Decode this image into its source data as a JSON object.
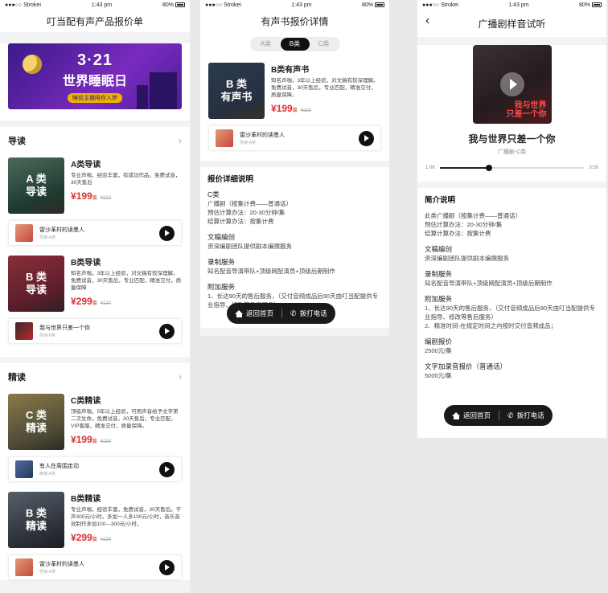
{
  "status": {
    "carrier": "●●●○○ Strokei",
    "time": "1:43 pm",
    "battery": "80%"
  },
  "p1": {
    "title": "叮当配有声产品报价单",
    "banner": {
      "line1": "3·21",
      "line2": "世界睡眠日",
      "line3": "睡前主播陪你入梦"
    },
    "sections": [
      {
        "title": "导读",
        "items": [
          {
            "cover": "A 类\n导读",
            "cover_l1": "A 类",
            "cover_l2": "导读",
            "name": "A类导读",
            "desc": "专业声咖，经验丰富，有成功作品。免费试音，30天售后",
            "price": "199",
            "unit": "篇",
            "old": "¥220",
            "sample": {
              "title": "雷沙革村的读墨人",
              "sub": "导读-A类"
            }
          },
          {
            "cover_l1": "B 类",
            "cover_l2": "导读",
            "name": "B类导读",
            "desc": "知名声咖，3年以上经验，对文稿有较深理解。免费试音，30天售后，专业匹配，精准交付，质量保障",
            "price": "299",
            "unit": "篇",
            "old": "¥220",
            "sample": {
              "title": "我与世界只差一个你",
              "sub": "导读-B类"
            }
          }
        ]
      },
      {
        "title": "精读",
        "items": [
          {
            "cover_l1": "C 类",
            "cover_l2": "精读",
            "name": "C类精读",
            "desc": "顶级声咖，5年以上经验，可用声音给予文字第二次生命。免费试音，30天售后，专业匹配，VIP客服，精准交付，质量保障。",
            "price": "199",
            "unit": "篇",
            "old": "¥220",
            "sample": {
              "title": "有人在周围走动",
              "sub": "精读-A类"
            }
          },
          {
            "cover_l1": "B 类",
            "cover_l2": "精读",
            "name": "B类精读",
            "desc": "专业声咖，经验丰富，免费试音，30天售后。干声300元/小时，多加一人多100元/小时，音乐音效制作多加100—300元/小时。",
            "price": "299",
            "unit": "篇",
            "old": "¥220",
            "sample": {
              "title": "雷沙革村的读墨人",
              "sub": "导读-A类"
            }
          }
        ]
      }
    ]
  },
  "p2": {
    "title": "有声书报价详情",
    "tabs": [
      "A类",
      "B类",
      "C类"
    ],
    "product": {
      "cover_l1": "B 类",
      "cover_l2": "有声书",
      "name": "B类有声书",
      "desc": "知名声咖，3年以上经验，对文稿有较深理解。免费试音，30天售后，专业匹配，精准交付，质量保障。",
      "price": "199",
      "unit": "篇",
      "old": "¥220",
      "sample": {
        "title": "雷沙革村的读墨人",
        "sub": "导读-A类"
      }
    },
    "detail_title": "报价详细说明",
    "blocks": [
      {
        "h": "C类",
        "lines": [
          "广播剧（按集计费——普通话）",
          "预估计算办法：20-30分钟/集",
          "结算计算办法：按集计费"
        ]
      },
      {
        "h": "文稿编创",
        "lines": [
          "资深编剧团队提供剧本编撰服务"
        ]
      },
      {
        "h": "录制服务",
        "lines": [
          "知名配音导演带队+顶级网配演员+顶级后期制作"
        ]
      },
      {
        "h": "附加服务",
        "lines": [
          "1、长达90天的售后服务，（交付音频成品后90天由叮当配提供专业指导、修改等售后服务）"
        ]
      }
    ]
  },
  "p3": {
    "title": "广播剧样音试听",
    "cover_text_l1": "我与世界",
    "cover_text_l2": "只差一个你",
    "track_title": "我与世界只差一个你",
    "track_sub": "广播剧-C类",
    "time_current": "1:06",
    "time_total": "3:56",
    "progress": 0.34,
    "blocks": [
      {
        "h": "简介说明",
        "lines": []
      },
      {
        "h": "此类广播剧（按集计费——普通话）",
        "lines": [
          "预估计算办法：20-30分钟/集",
          "结算计算办法：按集计费"
        ]
      },
      {
        "h": "文稿编创",
        "lines": [
          "资深编剧团队提供剧本编撰服务"
        ]
      },
      {
        "h": "录制服务",
        "lines": [
          "知名配音导演带队+顶级网配演员+顶级后期制作"
        ]
      },
      {
        "h": "附加服务",
        "lines": [
          "1、长达90天的售后服务，（交付音频成品后90天由叮当配提供专业指导、修改等售后服务）",
          "2、精准时间-在规定时间之内按时交付音频成品；"
        ]
      },
      {
        "h": "编剧报价",
        "lines": [
          "2500元/集"
        ]
      },
      {
        "h": "文字加录音报价（普通话）",
        "lines": [
          "5000元/集"
        ]
      }
    ]
  },
  "bottombar": {
    "home": "返回首页",
    "call": "拨打电话"
  }
}
